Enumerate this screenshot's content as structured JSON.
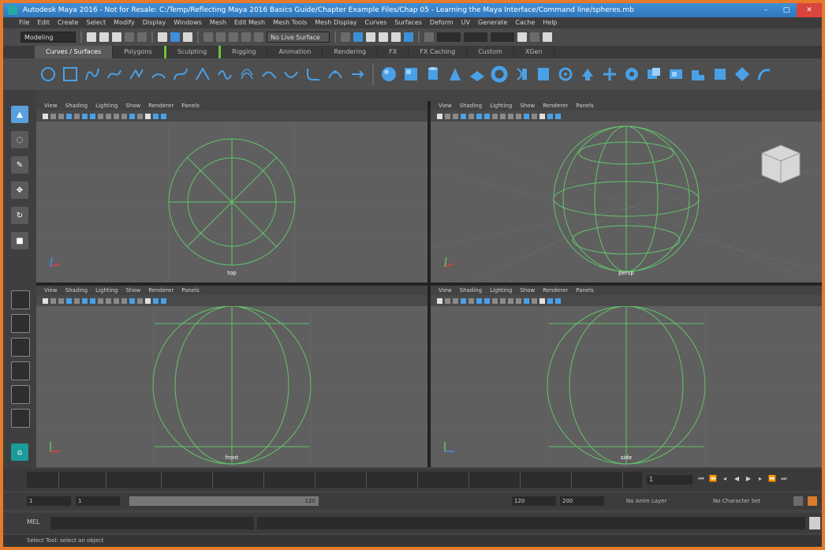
{
  "window": {
    "title": "Autodesk Maya 2016 - Not for Resale: C:/Temp/Reflecting Maya 2016 Basics Guide/Chapter Example Files/Chap 05 - Learning the Maya Interface/Command line/spheres.mb",
    "close_glyph": "✕",
    "min_glyph": "–",
    "max_glyph": "□"
  },
  "menubar": [
    "File",
    "Edit",
    "Create",
    "Select",
    "Modify",
    "Display",
    "Windows",
    "Mesh",
    "Edit Mesh",
    "Mesh Tools",
    "Mesh Display",
    "Curves",
    "Surfaces",
    "Deform",
    "UV",
    "Generate",
    "Cache",
    "Help"
  ],
  "status_line": {
    "menu_set": "Modeling",
    "live_surface": "No Live Surface"
  },
  "shelf_tabs": [
    {
      "label": "Curves / Surfaces",
      "active": true,
      "green": false
    },
    {
      "label": "Polygons",
      "active": false,
      "green": false
    },
    {
      "label": "Sculpting",
      "active": false,
      "green": true
    },
    {
      "label": "Rigging",
      "active": false,
      "green": true
    },
    {
      "label": "Animation",
      "active": false,
      "green": false
    },
    {
      "label": "Rendering",
      "active": false,
      "green": false
    },
    {
      "label": "FX",
      "active": false,
      "green": false
    },
    {
      "label": "FX Caching",
      "active": false,
      "green": false
    },
    {
      "label": "Custom",
      "active": false,
      "green": false
    },
    {
      "label": "XGen",
      "active": false,
      "green": false
    }
  ],
  "viewport_menu": [
    "View",
    "Shading",
    "Lighting",
    "Show",
    "Renderer",
    "Panels"
  ],
  "viewports": [
    {
      "label": "top"
    },
    {
      "label": "persp"
    },
    {
      "label": "front"
    },
    {
      "label": "side"
    }
  ],
  "colors": {
    "wire": "#62c46a",
    "accent": "#4aa0e6",
    "border": "#e87a2c"
  },
  "timeline": {
    "current_frame": "1"
  },
  "range": {
    "start": "1",
    "start_inner": "1",
    "end_inner": "120",
    "end": "120",
    "end_outer": "200",
    "anim_layer": "No Anim Layer",
    "char_set": "No Character Set"
  },
  "command_line": {
    "label": "MEL"
  },
  "help_line": "Select Tool: select an object"
}
